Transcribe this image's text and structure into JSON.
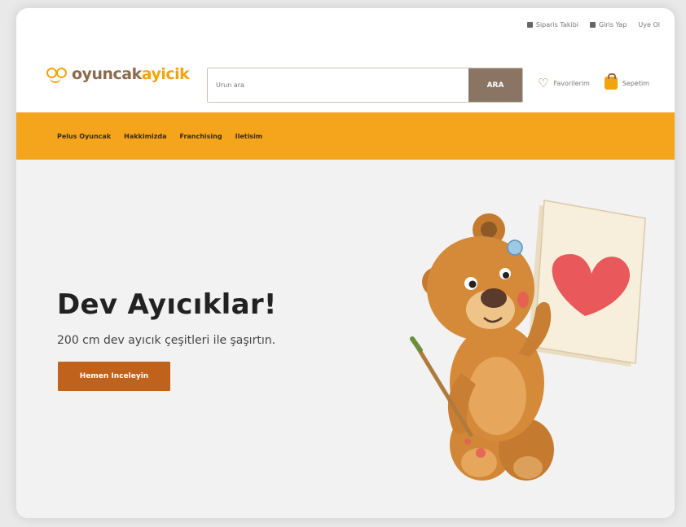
{
  "topbar": {
    "orders": "Siparis Takibi",
    "login": "Giris Yap",
    "register": "Uye Ol"
  },
  "logo": {
    "part1": "oyuncak",
    "part2": "ayicik"
  },
  "search": {
    "placeholder": "Urun ara",
    "button": "ARA"
  },
  "header_actions": {
    "favorites": "Favorilerim",
    "cart": "Sepetim"
  },
  "nav": {
    "items": [
      "Pelus Oyuncak",
      "Hakkimizda",
      "Franchising",
      "Iletisim"
    ]
  },
  "hero": {
    "title": "Dev Ayıcıklar!",
    "subtitle": "200 cm dev ayıcık çeşitleri ile şaşırtın.",
    "cta": "Hemen Inceleyin"
  },
  "colors": {
    "brand_orange": "#f4a51c",
    "brand_brown": "#8b6a4e",
    "cta": "#c0621c",
    "search_button": "#8a7564"
  }
}
